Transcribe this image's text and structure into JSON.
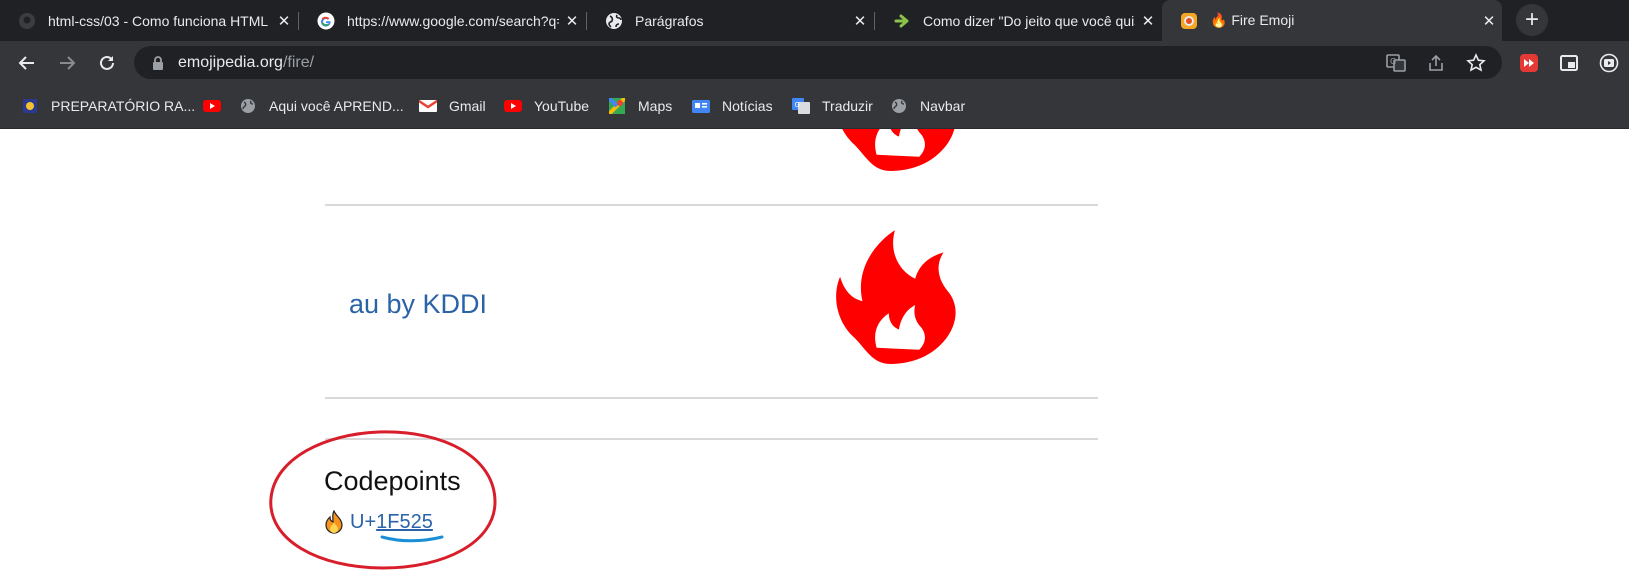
{
  "tabs": [
    {
      "title": "html-css/03 - Como funciona HTML",
      "favicon": "github-icon",
      "active": false
    },
    {
      "title": "https://www.google.com/search?q=",
      "favicon": "google-icon",
      "active": false
    },
    {
      "title": "Parágrafos",
      "favicon": "globe-icon",
      "active": false
    },
    {
      "title": "Como dizer \"Do jeito que você quiser\"",
      "favicon": "arrow-icon",
      "active": false
    },
    {
      "title": "🔥 Fire Emoji",
      "favicon": "emojipedia-icon",
      "active": true
    }
  ],
  "toolbar": {
    "url_host": "emojipedia.org",
    "url_path": "/fire/"
  },
  "bookmarks": [
    {
      "label": "PREPARATÓRIO RA...",
      "icon": "prep-icon"
    },
    {
      "label": "",
      "icon": "youtube-icon"
    },
    {
      "label": "Aqui você APREND...",
      "icon": "globe-icon"
    },
    {
      "label": "Gmail",
      "icon": "gmail-icon"
    },
    {
      "label": "YouTube",
      "icon": "youtube-icon"
    },
    {
      "label": "Maps",
      "icon": "maps-icon"
    },
    {
      "label": "Notícias",
      "icon": "news-icon"
    },
    {
      "label": "Traduzir",
      "icon": "translate-icon"
    },
    {
      "label": "Navbar",
      "icon": "globe-icon"
    }
  ],
  "content": {
    "vendor_name": "au by KDDI",
    "codepoints_title": "Codepoints",
    "codepoint_emoji": "🔥",
    "codepoint_prefix": "U+",
    "codepoint_value": "1F525"
  },
  "colors": {
    "flame_red": "#ff0000",
    "link_blue": "#2b63a8",
    "annotation_red": "#d81e2a",
    "annotation_blue": "#1a8fd6"
  }
}
